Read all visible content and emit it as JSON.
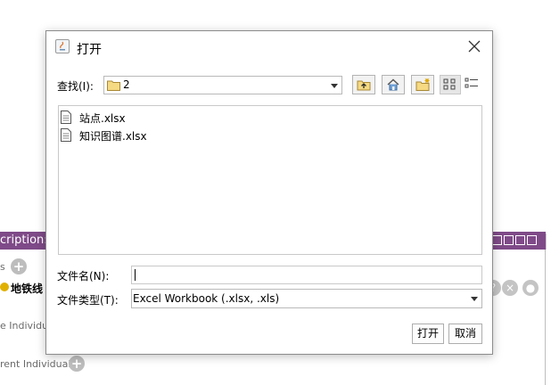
{
  "background_app": {
    "section_title": "cription:",
    "line_s": "s",
    "entity_label": "地铁线",
    "line_individuals": "e Individual",
    "line_current_individuals": "rent Individuals"
  },
  "dialog": {
    "title": "打开",
    "look_in_label": "查找(I):",
    "look_in_value": "2",
    "toolbar_icons": [
      "up-folder-icon",
      "home-icon",
      "new-folder-icon",
      "list-view-icon",
      "details-view-icon"
    ],
    "files": [
      {
        "name": "站点.xlsx",
        "icon": "file-icon"
      },
      {
        "name": "知识图谱.xlsx",
        "icon": "file-icon"
      }
    ],
    "file_name_label": "文件名(N):",
    "file_name_value": "",
    "file_type_label": "文件类型(T):",
    "file_type_value": "Excel Workbook (.xlsx, .xls)",
    "open_label": "打开",
    "cancel_label": "取消"
  },
  "colors": {
    "accent_bar": "#7f4a88",
    "dialog_border": "#8c8c8c"
  }
}
